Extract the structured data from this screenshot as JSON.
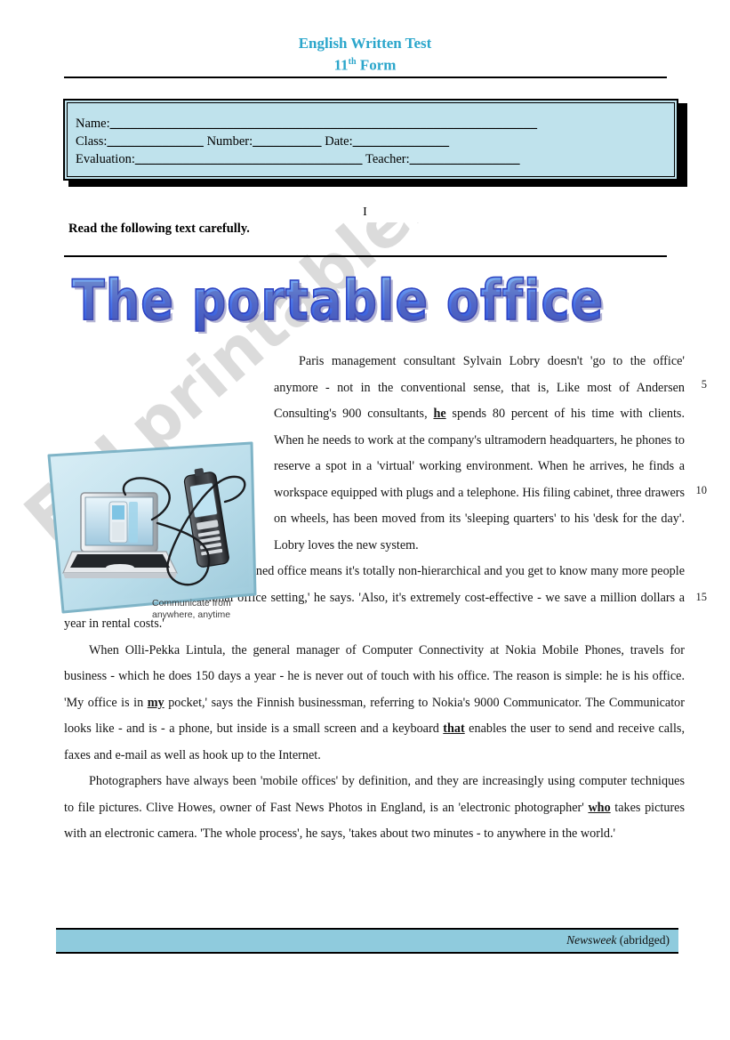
{
  "header": {
    "title_line1": "English Written Test",
    "title_line2_number": "11",
    "title_line2_sup": "th",
    "title_line2_rest": " Form",
    "accent_color": "#2BA6CB"
  },
  "identification": {
    "name_label": "Name:",
    "name_blank": "______________________________________________________________",
    "class_label": "Class:",
    "class_blank": "______________",
    "number_label": "Number:",
    "number_blank": "__________",
    "date_label": "Date:",
    "date_blank": "______________",
    "evaluation_label": "Evaluation:",
    "evaluation_blank": "_________________________________",
    "teacher_label": "Teacher:",
    "teacher_blank": "________________",
    "background_color": "#BFE2EC"
  },
  "section": {
    "numeral": "I",
    "instruction": "Read the following text carefully."
  },
  "article": {
    "title": "The portable office",
    "paragraphs": [
      "Paris management consultant Sylvain Lobry doesn't 'go to the office' anymore - not in the conventional sense, that is, Like most of Andersen Consulting's 900 consultants, |he| spends 80 percent of his time with clients. When he needs to work at the company's ultramodern headquarters, he phones to reserve a spot in a 'virtual' working environment. When he arrives, he finds a workspace equipped with plugs and a telephone. His filing cabinet, three drawers on wheels, has been moved from its 'sleeping quarters' to his 'desk for the day'. Lobry loves the new system.",
      "'The fact that no one has an assigned office means it's totally non-hierarchical and you get to know many more people than you would in the traditional office setting,' he says. 'Also, it's extremely cost-effective - we save a million dollars a year in rental costs.'",
      "When Olli-Pekka Lintula, the general manager of Computer Connectivity at Nokia Mobile Phones, travels for business - which he does 150 days a year - he is never out of touch with his office. The reason is simple: he is his office. 'My office is in |my| pocket,' says the Finnish businessman, referring to Nokia's 9000 Communicator. The Communicator looks like - and is - a phone, but inside is a small screen and a keyboard |that| enables the user to send and receive calls, faxes and e-mail as well as hook up to the Internet.",
      "Photographers have always been 'mobile offices' by definition, and they are increasingly using computer techniques to file pictures. Clive Howes, owner of Fast News Photos in England, is an 'electronic photographer' |who| takes pictures with an electronic camera. 'The whole process', he says, 'takes about two minutes - to anywhere in the world.'"
    ],
    "emphasised_words": [
      "he",
      "my",
      "that",
      "who"
    ],
    "line_numbers": [
      "5",
      "10",
      "15"
    ]
  },
  "illustration": {
    "caption_line1": "Communicate from",
    "caption_line2": "anywhere, anytime",
    "alt": "laptop connected to a mobile phone"
  },
  "footer": {
    "source": "Newsweek",
    "note": " (abridged)",
    "band_color": "#8FCBDD"
  },
  "watermark": {
    "text": "ESLprintables.com"
  }
}
